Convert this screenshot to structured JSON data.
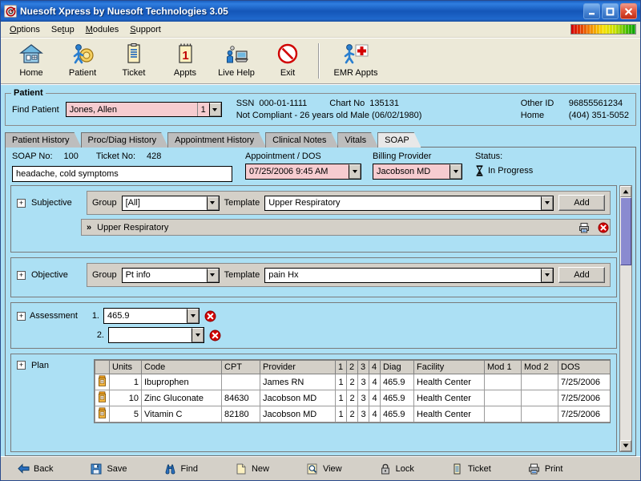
{
  "window": {
    "title": "Nuesoft Xpress by Nuesoft Technologies 3.05",
    "app_icon": "app-logo-icon",
    "minimize": "minimize-icon",
    "maximize": "maximize-icon",
    "close": "close-icon"
  },
  "menu": {
    "items": [
      {
        "label": "Options",
        "accel": "O"
      },
      {
        "label": "Setup",
        "accel": "t"
      },
      {
        "label": "Modules",
        "accel": "M"
      },
      {
        "label": "Support",
        "accel": "S"
      }
    ]
  },
  "toolbar": {
    "buttons": [
      {
        "label": "Home",
        "icon": "house-icon"
      },
      {
        "label": "Patient",
        "icon": "patient-person-icon"
      },
      {
        "label": "Ticket",
        "icon": "clipboard-icon"
      },
      {
        "label": "Appts",
        "icon": "calendar-one-icon"
      },
      {
        "label": "Live Help",
        "icon": "live-help-icon"
      },
      {
        "label": "Exit",
        "icon": "exit-circle-x-icon"
      }
    ],
    "buttons_after_sep": [
      {
        "label": "EMR Appts",
        "icon": "emr-person-cross-icon"
      }
    ]
  },
  "patient": {
    "group_title": "Patient",
    "find_label": "Find Patient",
    "name_value": "Jones, Allen",
    "seq_value": "1",
    "ssn_label": "SSN",
    "ssn_value": "000-01-1111",
    "chart_label": "Chart No",
    "chart_value": "135131",
    "status_line": "Not Compliant - 26 years old Male (06/02/1980)",
    "other_id_label": "Other ID",
    "other_id_value": "96855561234",
    "home_label": "Home",
    "home_value": "(404) 351-5052"
  },
  "tabs": [
    {
      "label": "Patient History",
      "active": false
    },
    {
      "label": "Proc/Diag History",
      "active": false
    },
    {
      "label": "Appointment History",
      "active": false
    },
    {
      "label": "Clinical Notes",
      "active": false
    },
    {
      "label": "Vitals",
      "active": false
    },
    {
      "label": "SOAP",
      "active": true
    }
  ],
  "soap": {
    "soap_no_label": "SOAP No:",
    "soap_no_value": "100",
    "ticket_no_label": "Ticket No:",
    "ticket_no_value": "428",
    "chief_complaint": "headache, cold symptoms",
    "appointment_label": "Appointment / DOS",
    "appointment_value": "07/25/2006 9:45 AM",
    "billing_label": "Billing Provider",
    "billing_value": "Jacobson MD",
    "status_label": "Status:",
    "status_value": "In Progress",
    "status_icon": "hourglass-icon"
  },
  "subjective": {
    "name": "Subjective",
    "expander": "+",
    "group_label": "Group",
    "group_value": "[All]",
    "template_label": "Template",
    "template_value": "Upper Respiratory",
    "add_label": "Add",
    "items": [
      {
        "chevron": "»",
        "text": "Upper Respiratory",
        "print_icon": "print-icon",
        "delete_icon": "delete-x-icon"
      }
    ]
  },
  "objective": {
    "name": "Objective",
    "expander": "+",
    "group_label": "Group",
    "group_value": "Pt info",
    "template_label": "Template",
    "template_value": "pain Hx",
    "add_label": "Add"
  },
  "assessment": {
    "name": "Assessment",
    "expander": "+",
    "rows": [
      {
        "num": "1.",
        "value": "465.9",
        "delete_icon": "delete-x-icon"
      },
      {
        "num": "2.",
        "value": "",
        "delete_icon": "delete-x-icon"
      }
    ]
  },
  "plan": {
    "name": "Plan",
    "expander": "+",
    "columns": [
      "",
      "Units",
      "Code",
      "CPT",
      "Provider",
      "1",
      "2",
      "3",
      "4",
      "Diag",
      "Facility",
      "Mod 1",
      "Mod 2",
      "DOS",
      ""
    ],
    "rows": [
      {
        "icon": "pill-bottle-icon",
        "units": "1",
        "code": "Ibuprophen",
        "cpt": "",
        "provider": "James RN",
        "c1": "1",
        "c2": "2",
        "c3": "3",
        "c4": "4",
        "selected_col": "1",
        "diag": "465.9",
        "facility": "Health Center",
        "mod1": "",
        "mod2": "",
        "dos": "7/25/2006",
        "delete_icon": "delete-x-icon"
      },
      {
        "icon": "pill-bottle-icon",
        "units": "10",
        "code": "Zinc Gluconate",
        "cpt": "84630",
        "provider": "Jacobson MD",
        "c1": "1",
        "c2": "2",
        "c3": "3",
        "c4": "4",
        "selected_col": "1",
        "diag": "465.9",
        "facility": "Health Center",
        "mod1": "",
        "mod2": "",
        "dos": "7/25/2006",
        "delete_icon": "delete-x-icon"
      },
      {
        "icon": "pill-bottle-icon",
        "units": "5",
        "code": "Vitamin C",
        "cpt": "82180",
        "provider": "Jacobson MD",
        "c1": "1",
        "c2": "2",
        "c3": "3",
        "c4": "4",
        "selected_col": "1",
        "diag": "465.9",
        "facility": "Health Center",
        "mod1": "",
        "mod2": "",
        "dos": "7/25/2006",
        "delete_icon": "delete-x-icon"
      }
    ]
  },
  "bottom_bar": {
    "buttons": [
      {
        "label": "Back",
        "icon": "back-arrow-icon"
      },
      {
        "label": "Save",
        "icon": "floppy-disk-icon"
      },
      {
        "label": "Find",
        "icon": "binoculars-icon"
      },
      {
        "label": "New",
        "icon": "new-page-icon"
      },
      {
        "label": "View",
        "icon": "magnifier-icon"
      },
      {
        "label": "Lock",
        "icon": "padlock-icon"
      },
      {
        "label": "Ticket",
        "icon": "clipboard-icon"
      },
      {
        "label": "Print",
        "icon": "printer-icon"
      }
    ]
  },
  "colors": {
    "window_blue": "#ace0f4",
    "chrome_gray": "#d4d0c8",
    "pink_field": "#f6ccd0",
    "accent_green": "#00e000",
    "title_blue": "#1456b8",
    "delete_red": "#d01010"
  },
  "scrollbar": {
    "up_icon": "scroll-up-icon",
    "down_icon": "scroll-down-icon",
    "thumb": "scroll-thumb"
  }
}
